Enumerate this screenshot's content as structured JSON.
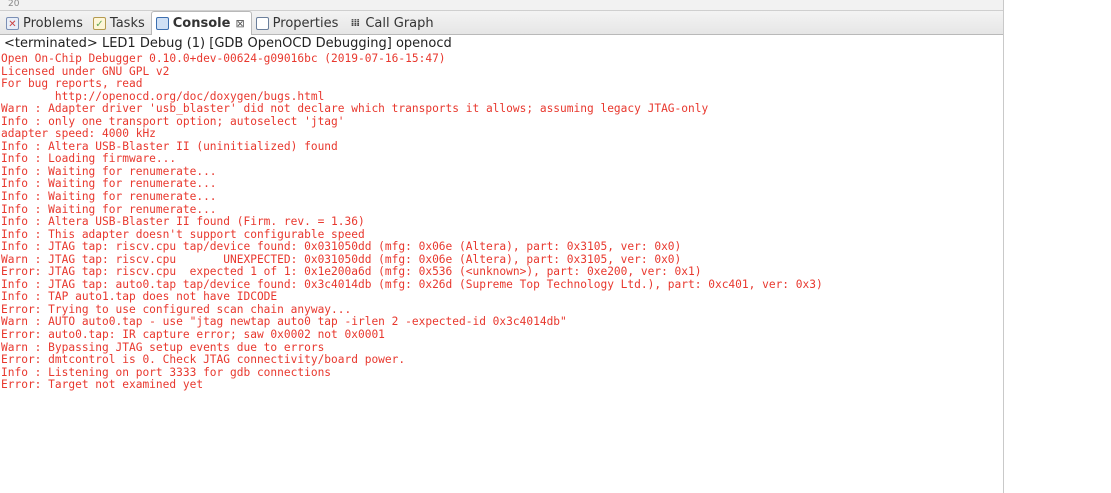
{
  "top_remnant": "20",
  "tabs": [
    {
      "label": "Problems",
      "icon": "problems-icon",
      "active": false
    },
    {
      "label": "Tasks",
      "icon": "tasks-icon",
      "active": false
    },
    {
      "label": "Console",
      "icon": "console-icon",
      "active": true,
      "close": "⊠"
    },
    {
      "label": "Properties",
      "icon": "properties-icon",
      "active": false
    },
    {
      "label": "Call Graph",
      "icon": "call-graph-icon",
      "active": false
    }
  ],
  "status": "<terminated> LED1 Debug (1) [GDB OpenOCD Debugging] openocd",
  "console_color": "#e8382e",
  "console_lines": [
    "Open On-Chip Debugger 0.10.0+dev-00624-g09016bc (2019-07-16-15:47)",
    "Licensed under GNU GPL v2",
    "For bug reports, read",
    "        http://openocd.org/doc/doxygen/bugs.html",
    "Warn : Adapter driver 'usb_blaster' did not declare which transports it allows; assuming legacy JTAG-only",
    "Info : only one transport option; autoselect 'jtag'",
    "adapter speed: 4000 kHz",
    "Info : Altera USB-Blaster II (uninitialized) found",
    "Info : Loading firmware...",
    "Info : Waiting for renumerate...",
    "Info : Waiting for renumerate...",
    "Info : Waiting for renumerate...",
    "Info : Waiting for renumerate...",
    "Info : Altera USB-Blaster II found (Firm. rev. = 1.36)",
    "Info : This adapter doesn't support configurable speed",
    "Info : JTAG tap: riscv.cpu tap/device found: 0x031050dd (mfg: 0x06e (Altera), part: 0x3105, ver: 0x0)",
    "Warn : JTAG tap: riscv.cpu       UNEXPECTED: 0x031050dd (mfg: 0x06e (Altera), part: 0x3105, ver: 0x0)",
    "Error: JTAG tap: riscv.cpu  expected 1 of 1: 0x1e200a6d (mfg: 0x536 (<unknown>), part: 0xe200, ver: 0x1)",
    "Info : JTAG tap: auto0.tap tap/device found: 0x3c4014db (mfg: 0x26d (Supreme Top Technology Ltd.), part: 0xc401, ver: 0x3)",
    "Info : TAP auto1.tap does not have IDCODE",
    "Error: Trying to use configured scan chain anyway...",
    "Warn : AUTO auto0.tap - use \"jtag newtap auto0 tap -irlen 2 -expected-id 0x3c4014db\"",
    "Error: auto0.tap: IR capture error; saw 0x0002 not 0x0001",
    "Warn : Bypassing JTAG setup events due to errors",
    "Error: dmtcontrol is 0. Check JTAG connectivity/board power.",
    "Info : Listening on port 3333 for gdb connections",
    "Error: Target not examined yet"
  ]
}
